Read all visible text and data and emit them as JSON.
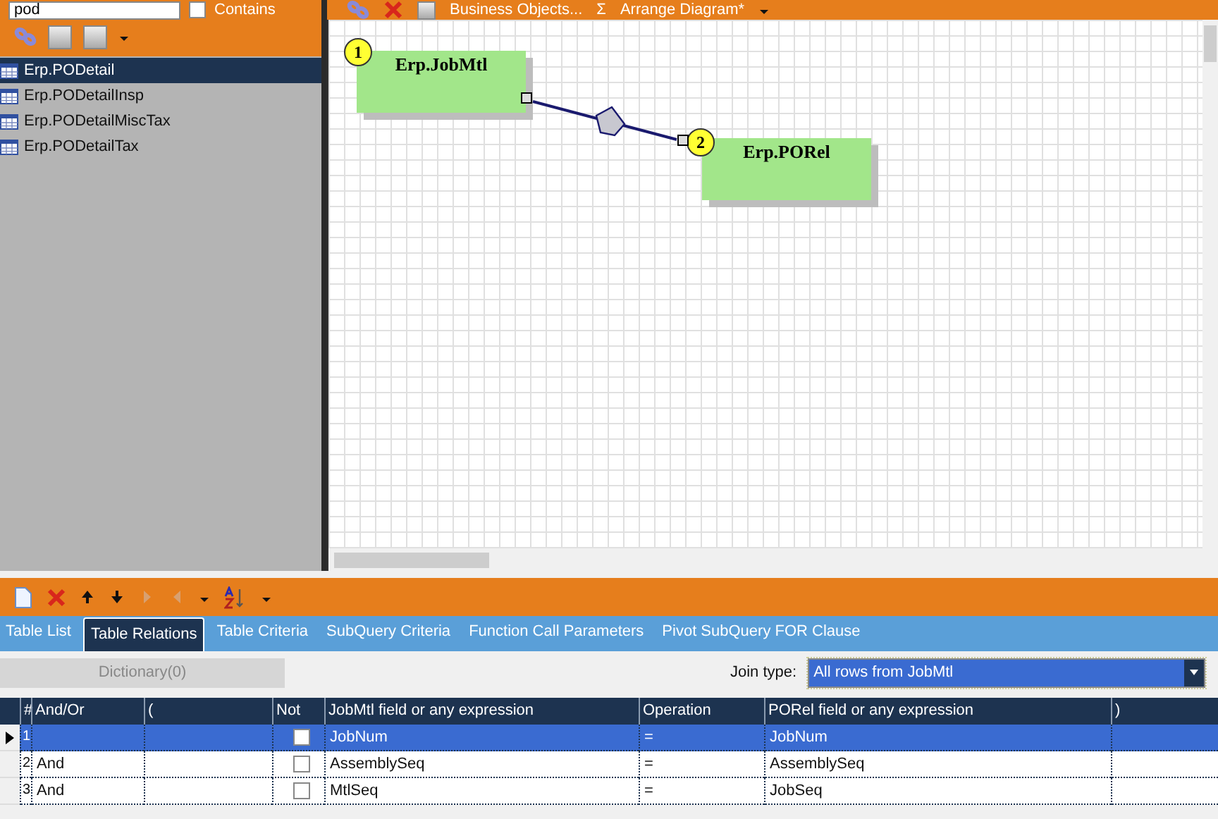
{
  "left_panel": {
    "search": {
      "value": "pod"
    },
    "contains": {
      "label": "Contains",
      "checked": false
    },
    "tables": [
      {
        "name": "Erp.PODetail",
        "selected": true
      },
      {
        "name": "Erp.PODetailInsp",
        "selected": false
      },
      {
        "name": "Erp.PODetailMiscTax",
        "selected": false
      },
      {
        "name": "Erp.PODetailTax",
        "selected": false
      }
    ]
  },
  "diagram": {
    "toolbar": {
      "business_objects": "Business Objects...",
      "sum": "Σ",
      "arrange": "Arrange Diagram*"
    },
    "nodes": [
      {
        "number": "1",
        "name": "Erp.JobMtl"
      },
      {
        "number": "2",
        "name": "Erp.PORel"
      }
    ]
  },
  "tabs": [
    {
      "label": "Table List",
      "selected": false
    },
    {
      "label": "Table Relations",
      "selected": true
    },
    {
      "label": "Table Criteria",
      "selected": false
    },
    {
      "label": "SubQuery Criteria",
      "selected": false
    },
    {
      "label": "Function Call Parameters",
      "selected": false
    },
    {
      "label": "Pivot SubQuery FOR Clause",
      "selected": false
    }
  ],
  "dictionary_button": {
    "label": "Dictionary(0)",
    "disabled": true
  },
  "join_type": {
    "label": "Join type:",
    "value": "All rows from JobMtl"
  },
  "grid": {
    "columns": [
      "#",
      "And/Or",
      "(",
      "Not",
      "JobMtl field or any expression",
      "Operation",
      "PORel field or any expression",
      ")"
    ],
    "rows": [
      {
        "number": "1",
        "not": false,
        "left_field": "JobNum",
        "operation": "=",
        "right_field": "JobNum",
        "selected": true
      },
      {
        "number": "2",
        "and_or": "And",
        "not": false,
        "left_field": "AssemblySeq",
        "operation": "=",
        "right_field": "AssemblySeq",
        "selected": false
      },
      {
        "number": "3",
        "and_or": "And",
        "not": false,
        "left_field": "MtlSeq",
        "operation": "=",
        "right_field": "JobSeq",
        "selected": false
      }
    ]
  }
}
